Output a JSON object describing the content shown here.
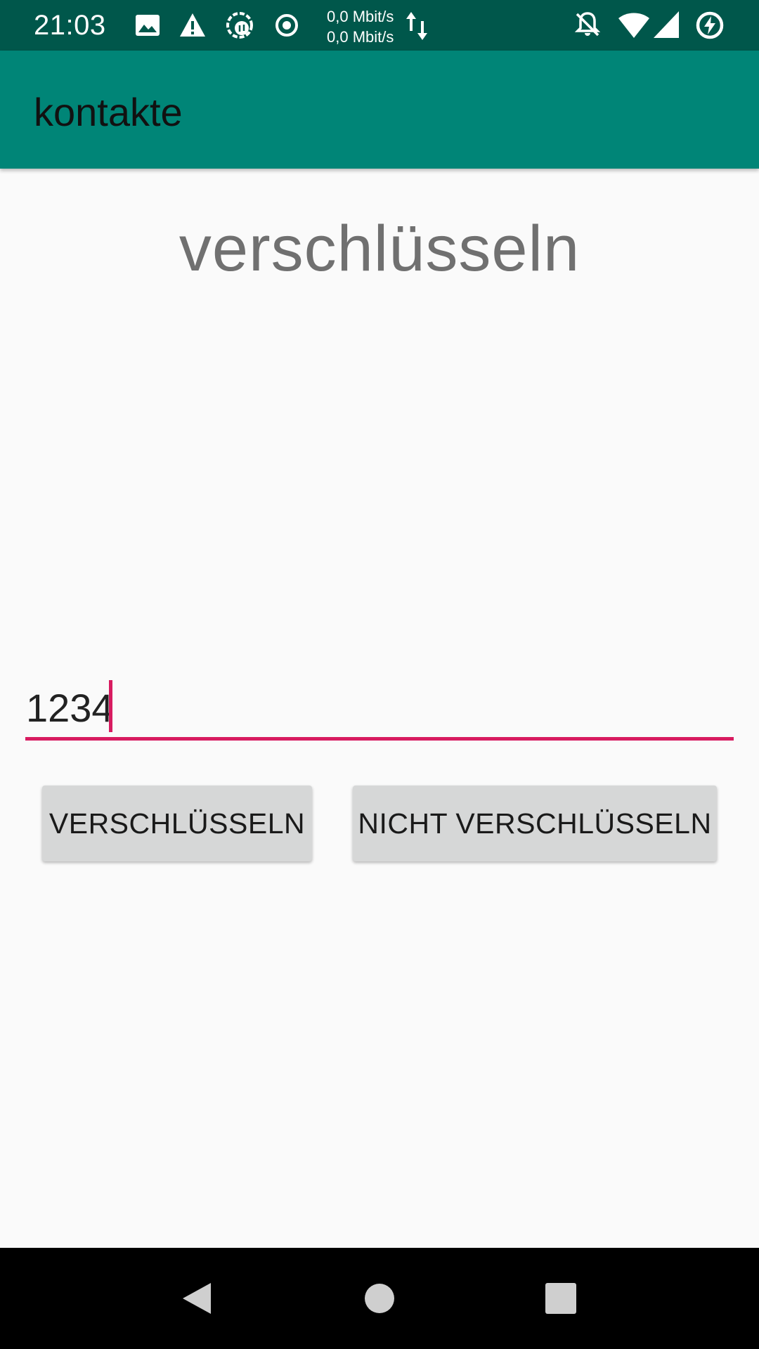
{
  "status_bar": {
    "time": "21:03",
    "net_up": "0,0 Mbit/s",
    "net_down": "0,0 Mbit/s",
    "icons": [
      "image-icon",
      "warning-icon",
      "sync-icon",
      "record-icon",
      "data-arrows-icon",
      "notifications-off-icon",
      "wifi-icon",
      "signal-icon",
      "battery-charging-icon"
    ],
    "background": "#00574b"
  },
  "app_bar": {
    "title": "kontakte",
    "background": "#008577"
  },
  "main": {
    "heading": "verschlüsseln",
    "input": {
      "value": "1234",
      "accent": "#d81b60"
    },
    "buttons": {
      "encrypt_label": "VERSCHLÜSSELN",
      "no_encrypt_label": "NICHT VERSCHLÜSSELN"
    }
  },
  "nav_bar": {
    "icons": [
      "back-icon",
      "home-icon",
      "recents-icon"
    ]
  }
}
